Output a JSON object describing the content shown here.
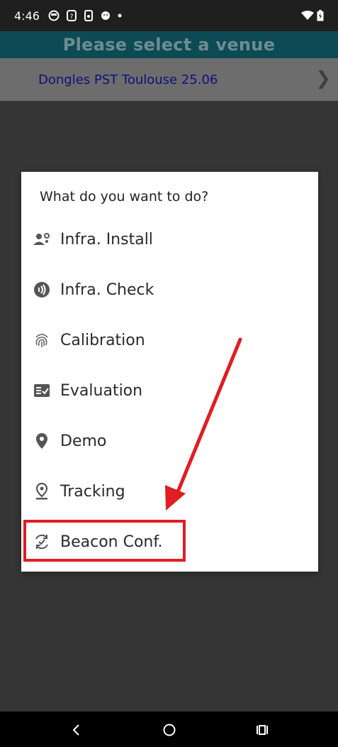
{
  "status_bar": {
    "time": "4:46"
  },
  "header": {
    "title": "Please select a venue"
  },
  "venue": {
    "name": "Dongles PST Toulouse 25.06",
    "chevron": "❯"
  },
  "dialog": {
    "title": "What do you want to do?",
    "items": [
      {
        "label": "Infra. Install",
        "icon": "person-settings-icon"
      },
      {
        "label": "Infra. Check",
        "icon": "signal-check-icon"
      },
      {
        "label": "Calibration",
        "icon": "fingerprint-icon"
      },
      {
        "label": "Evaluation",
        "icon": "checklist-icon"
      },
      {
        "label": "Demo",
        "icon": "location-pin-icon"
      },
      {
        "label": "Tracking",
        "icon": "pin-drop-icon"
      },
      {
        "label": "Beacon Conf.",
        "icon": "sync-check-icon"
      }
    ]
  },
  "annotation": {
    "highlight_color": "#e01d24",
    "target": "Beacon Conf."
  },
  "colors": {
    "header_bg": "#0c4a55",
    "header_text": "#6e8d91",
    "venue_row_bg": "#6d6d6d",
    "venue_text": "#10107a",
    "backdrop": "#353535"
  }
}
